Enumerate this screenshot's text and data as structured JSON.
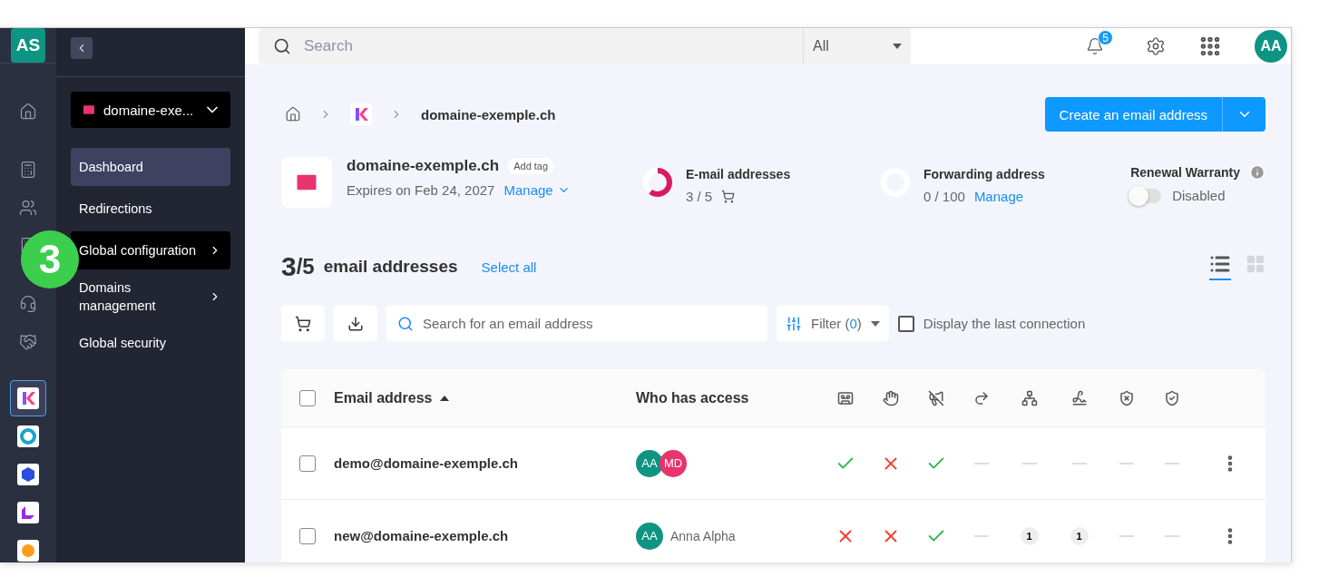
{
  "rail": {
    "account_badge": "AS",
    "apps": [
      {
        "kind": "k-logo",
        "selected": true
      },
      {
        "kind": "ring",
        "selected": false
      },
      {
        "kind": "cube",
        "selected": false
      },
      {
        "kind": "corner",
        "selected": false
      },
      {
        "kind": "sun",
        "selected": false
      }
    ]
  },
  "sidebar": {
    "domain_selector": "domaine-exe...",
    "items": [
      {
        "label": "Dashboard",
        "selected": true,
        "highlighted": false,
        "has_submenu": false
      },
      {
        "label": "Redirections",
        "selected": false,
        "highlighted": false,
        "has_submenu": false
      },
      {
        "label": "Global configuration",
        "selected": false,
        "highlighted": true,
        "has_submenu": true
      },
      {
        "label": "Domains management",
        "selected": false,
        "highlighted": false,
        "has_submenu": true
      },
      {
        "label": "Global security",
        "selected": false,
        "highlighted": false,
        "has_submenu": false
      }
    ]
  },
  "step_marker": "3",
  "header": {
    "search": {
      "placeholder": "Search"
    },
    "scope": "All",
    "notifications": "5",
    "avatar": "AA"
  },
  "breadcrumb": {
    "current": "domaine-exemple.ch"
  },
  "create_button": "Create an email address",
  "domain": {
    "name": "domaine-exemple.ch",
    "tag_button": "Add tag",
    "expiry": "Expires on Feb 24, 2027",
    "manage": "Manage"
  },
  "stats": [
    {
      "title": "E-mail addresses",
      "value": "3 / 5",
      "level": 0.6
    },
    {
      "title": "Forwarding address",
      "value": "0 / 100",
      "level": 0,
      "link": "Manage"
    }
  ],
  "renewal": {
    "title": "Renewal Warranty",
    "on": false,
    "status": "Disabled"
  },
  "summary": {
    "count": "3",
    "total": "/5",
    "label": "email addresses",
    "select_all": "Select all"
  },
  "view": {
    "list_selected": true
  },
  "toolbar": {
    "search_placeholder": "Search for an email address",
    "filter": "Filter (",
    "filter_count": "0",
    "filter_end": ")",
    "last_connection": {
      "label": "Display the last connection",
      "checked": false
    }
  },
  "table": {
    "all_checked": false,
    "columns": {
      "email": "Email address",
      "access": "Who has access"
    },
    "rows": [
      {
        "email": "demo@domaine-exemple.ch",
        "checked": false,
        "access": [
          {
            "initials": "AA",
            "color": "#0e9483"
          },
          {
            "initials": "MD",
            "color": "#e8336d"
          }
        ],
        "cells": [
          {
            "kind": "check"
          },
          {
            "kind": "cross"
          },
          {
            "kind": "check"
          },
          {
            "kind": "dash"
          },
          {
            "kind": "dash"
          },
          {
            "kind": "dash"
          },
          {
            "kind": "dash"
          },
          {
            "kind": "dash"
          }
        ]
      },
      {
        "email": "new@domaine-exemple.ch",
        "checked": false,
        "access": [
          {
            "initials": "AA",
            "color": "#0e9483"
          }
        ],
        "access_name": "Anna Alpha",
        "cells": [
          {
            "kind": "cross"
          },
          {
            "kind": "cross"
          },
          {
            "kind": "check"
          },
          {
            "kind": "dash"
          },
          {
            "kind": "count",
            "count": "1"
          },
          {
            "kind": "count",
            "count": "1"
          },
          {
            "kind": "dash"
          },
          {
            "kind": "dash"
          }
        ]
      }
    ]
  }
}
